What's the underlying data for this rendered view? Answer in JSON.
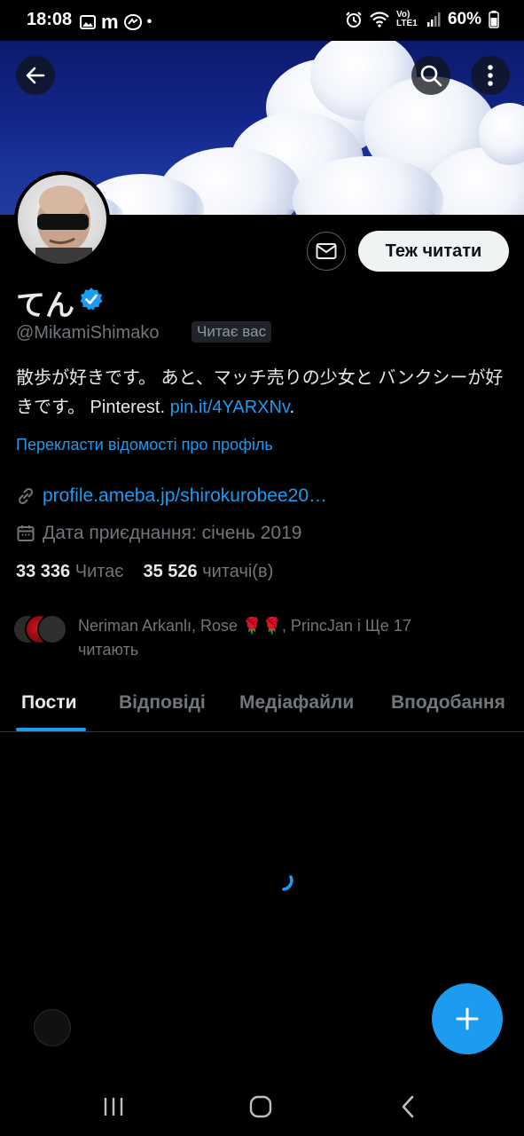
{
  "status_bar": {
    "time": "18:08",
    "left_icons": [
      "gallery-icon",
      "m-icon",
      "messenger-icon",
      "dot-icon"
    ],
    "m_letter": "m",
    "dot": "•",
    "network": "Vo) LTE1",
    "battery": "60%"
  },
  "profile": {
    "display_name": "てん",
    "handle": "@MikamiShimako",
    "follows_you": "Читає вас",
    "bio_text": "散歩が好きです。 あと、マッチ売りの少女と バンクシーが好きです。 Pinterest. ",
    "bio_link": "pin.it/4YARXNv",
    "bio_end": ".",
    "translate_label": "Перекласти відомості про профіль",
    "website": "profile.ameba.jp/shirokurobee20…",
    "joined": "Дата приєднання: січень 2019",
    "following_count": "33 336",
    "following_label": "Читає",
    "followers_count": "35 526",
    "followers_label": "читачі(в)",
    "mutual_text": "Neriman Arkanlı, Rose 🌹🌹, PrincJan і Ще 17 читають"
  },
  "actions": {
    "follow_label": "Теж читати"
  },
  "tabs": [
    {
      "label": "Пости",
      "active": true
    },
    {
      "label": "Відповіді",
      "active": false
    },
    {
      "label": "Медіафайли",
      "active": false
    },
    {
      "label": "Вподобання",
      "active": false
    }
  ],
  "colors": {
    "accent": "#1d9bf0",
    "background": "#000000",
    "secondary_text": "#71767b"
  }
}
